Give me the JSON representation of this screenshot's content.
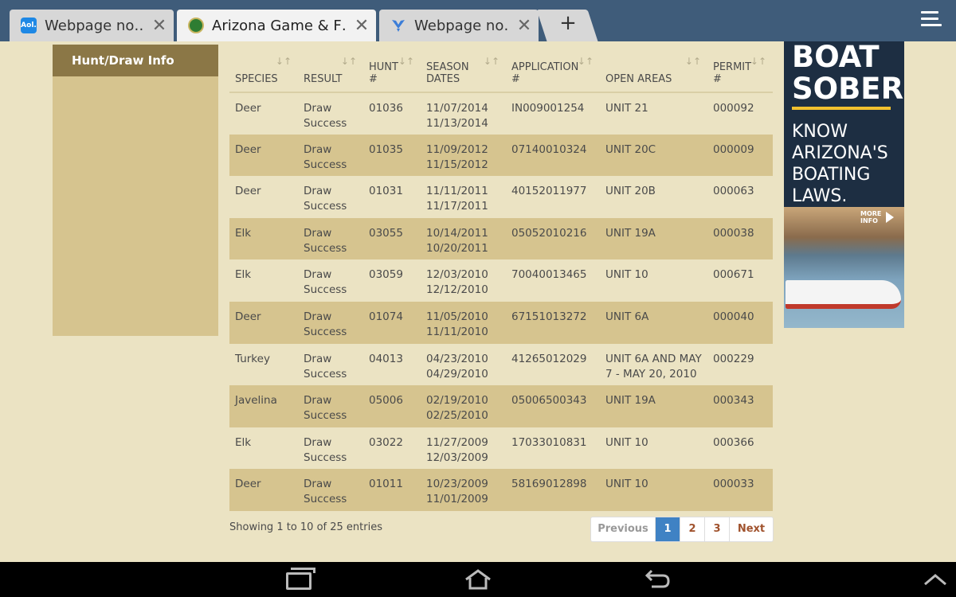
{
  "browser": {
    "tabs": [
      {
        "title": "Webpage no…",
        "favicon": "aol-icon",
        "favicon_text": "Aol.",
        "active": false
      },
      {
        "title": "Arizona Game & F…",
        "favicon": "azgfd-logo-icon",
        "active": true
      },
      {
        "title": "Webpage no…",
        "favicon": "blue-bird-icon",
        "active": false
      }
    ],
    "new_tab_label": "+",
    "close_glyph": "✕"
  },
  "sidebar": {
    "heading": "Hunt/Draw Info"
  },
  "table": {
    "columns": [
      {
        "line1": "",
        "line2": "SPECIES"
      },
      {
        "line1": "",
        "line2": "RESULT"
      },
      {
        "line1": "HUNT",
        "line2": "#"
      },
      {
        "line1": "SEASON",
        "line2": "DATES"
      },
      {
        "line1": "APPLICATION",
        "line2": "#"
      },
      {
        "line1": "",
        "line2": "OPEN AREAS"
      },
      {
        "line1": "PERMIT",
        "line2": "#"
      }
    ],
    "rows": [
      {
        "species": "Deer",
        "result1": "Draw",
        "result2": "Success",
        "hunt": "01036",
        "season1": "11/07/2014",
        "season2": "11/13/2014",
        "application": "IN009001254",
        "areas": "UNIT 21",
        "permit": "000092"
      },
      {
        "species": "Deer",
        "result1": "Draw",
        "result2": "Success",
        "hunt": "01035",
        "season1": "11/09/2012",
        "season2": "11/15/2012",
        "application": "07140010324",
        "areas": "UNIT 20C",
        "permit": "000009"
      },
      {
        "species": "Deer",
        "result1": "Draw",
        "result2": "Success",
        "hunt": "01031",
        "season1": "11/11/2011",
        "season2": "11/17/2011",
        "application": "40152011977",
        "areas": "UNIT 20B",
        "permit": "000063"
      },
      {
        "species": "Elk",
        "result1": "Draw",
        "result2": "Success",
        "hunt": "03055",
        "season1": "10/14/2011",
        "season2": "10/20/2011",
        "application": "05052010216",
        "areas": "UNIT 19A",
        "permit": "000038"
      },
      {
        "species": "Elk",
        "result1": "Draw",
        "result2": "Success",
        "hunt": "03059",
        "season1": "12/03/2010",
        "season2": "12/12/2010",
        "application": "70040013465",
        "areas": "UNIT 10",
        "permit": "000671"
      },
      {
        "species": "Deer",
        "result1": "Draw",
        "result2": "Success",
        "hunt": "01074",
        "season1": "11/05/2010",
        "season2": "11/11/2010",
        "application": "67151013272",
        "areas": "UNIT 6A",
        "permit": "000040"
      },
      {
        "species": "Turkey",
        "result1": "Draw",
        "result2": "Success",
        "hunt": "04013",
        "season1": "04/23/2010",
        "season2": "04/29/2010",
        "application": "41265012029",
        "areas": "UNIT 6A AND MAY 7 - MAY 20, 2010",
        "permit": "000229"
      },
      {
        "species": "Javelina",
        "result1": "Draw",
        "result2": "Success",
        "hunt": "05006",
        "season1": "02/19/2010",
        "season2": "02/25/2010",
        "application": "05006500343",
        "areas": "UNIT 19A",
        "permit": "000343"
      },
      {
        "species": "Elk",
        "result1": "Draw",
        "result2": "Success",
        "hunt": "03022",
        "season1": "11/27/2009",
        "season2": "12/03/2009",
        "application": "17033010831",
        "areas": "UNIT 10",
        "permit": "000366"
      },
      {
        "species": "Deer",
        "result1": "Draw",
        "result2": "Success",
        "hunt": "01011",
        "season1": "10/23/2009",
        "season2": "11/01/2009",
        "application": "58169012898",
        "areas": "UNIT 10",
        "permit": "000033"
      }
    ]
  },
  "footer": {
    "info": "Showing 1 to 10 of 25 entries",
    "pager": {
      "previous": "Previous",
      "pages": [
        "1",
        "2",
        "3"
      ],
      "current": "1",
      "next": "Next"
    }
  },
  "ad": {
    "title_line1": "BOAT",
    "title_line2": "SOBER",
    "sub_line1": "KNOW",
    "sub_line2": "ARIZONA'S",
    "sub_line3": "BOATING",
    "sub_line4": "LAWS.",
    "more_line1": "MORE",
    "more_line2": "INFO"
  },
  "colors": {
    "page_bg": "#ebe3c3",
    "row_alt": "#d6c48f",
    "sidebar_head": "#8b7746",
    "pager_active": "#3f82c4",
    "tabbar": "#3f5c7a"
  }
}
